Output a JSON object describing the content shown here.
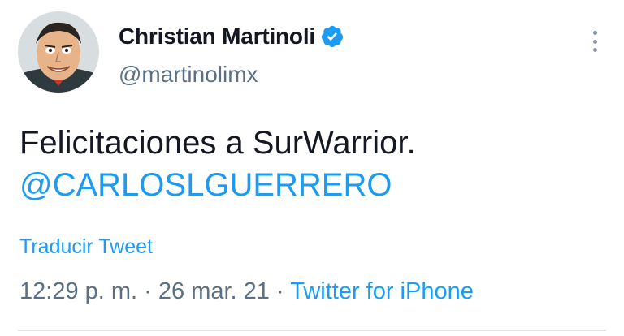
{
  "author": {
    "display_name": "Christian Martinoli",
    "handle": "@martinolimx",
    "verified": true,
    "avatar_icon": "caricature-avatar"
  },
  "tweet": {
    "text": "Felicitaciones a SurWarrior.",
    "mention": "@CARLOSLGUERRERO",
    "translate_label": "Traducir Tweet",
    "time": "12:29 p. m.",
    "date": "26 mar. 21",
    "separator": "·",
    "source": "Twitter for iPhone"
  },
  "menu_icon": "more-vertical-icon",
  "colors": {
    "accent": "#1d9bf0",
    "text": "#141823",
    "secondary": "#5b7083"
  }
}
